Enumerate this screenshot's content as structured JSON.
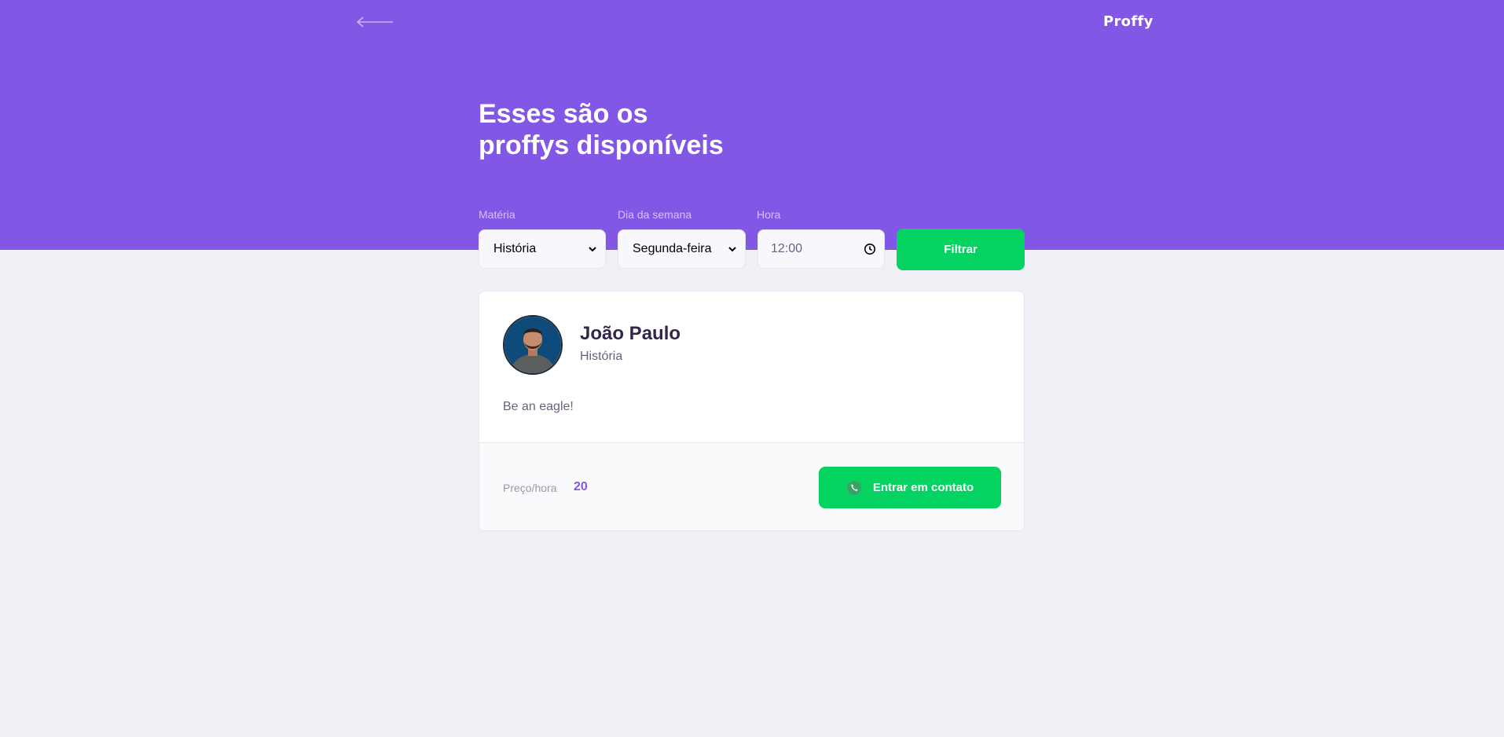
{
  "header": {
    "logo": "Proffy",
    "title_line1": "Esses são os",
    "title_line2": "proffys disponíveis"
  },
  "filters": {
    "subject_label": "Matéria",
    "subject_value": "História",
    "weekday_label": "Dia da semana",
    "weekday_value": "Segunda-feira",
    "time_label": "Hora",
    "time_value": "12:00",
    "filter_button": "Filtrar"
  },
  "teacher": {
    "name": "João Paulo",
    "subject": "História",
    "bio": "Be an eagle!",
    "price_label": "Preço/hora",
    "price_value": "20",
    "contact_button": "Entrar em contato"
  },
  "icons": {
    "back": "arrow-left-icon",
    "chevron": "chevron-down-icon",
    "clock": "clock-icon",
    "whatsapp": "whatsapp-icon"
  },
  "colors": {
    "primary": "#8257E5",
    "secondary": "#04D361",
    "background": "#F0F0F7",
    "title_text": "#32264D",
    "body_text": "#6A6180"
  }
}
